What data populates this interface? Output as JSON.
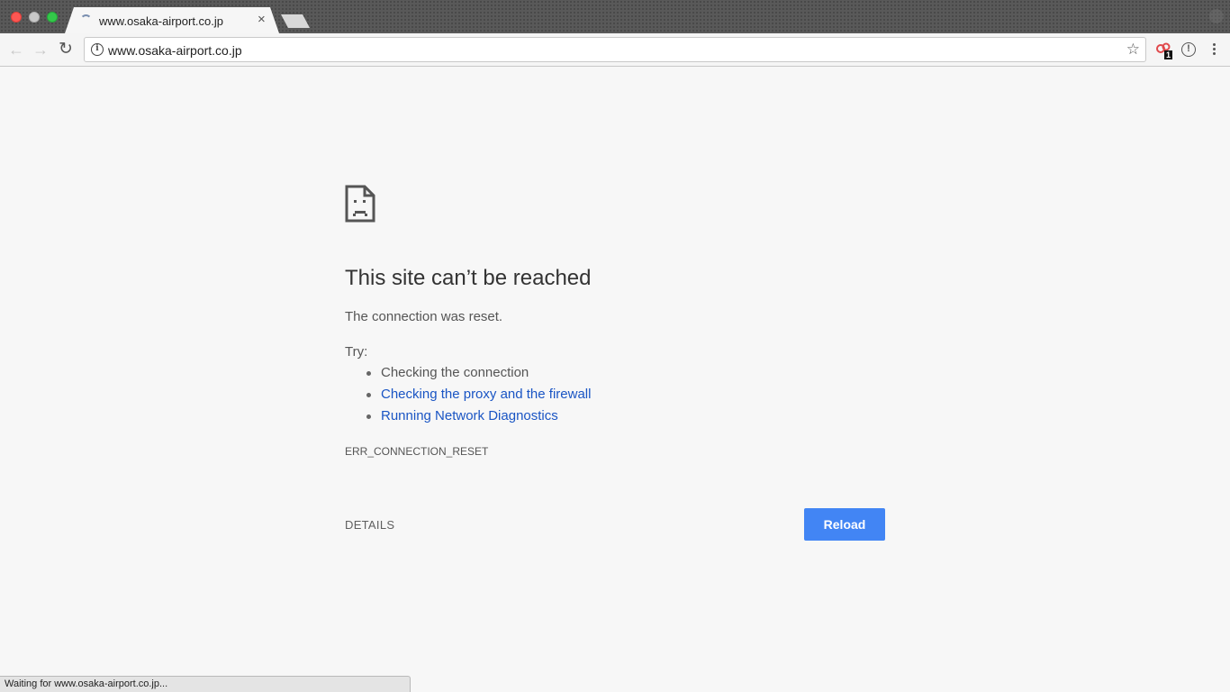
{
  "window": {
    "traffic_lights": [
      "close",
      "minimize",
      "maximize"
    ]
  },
  "tabs": [
    {
      "title": "www.osaka-airport.co.jp",
      "loading": true,
      "active": true,
      "close_label": "×"
    }
  ],
  "toolbar": {
    "back_icon": "←",
    "forward_icon": "→",
    "reload_icon": "↻",
    "url": "www.osaka-airport.co.jp",
    "info_icon": "i",
    "star_icon": "☆",
    "extension_badge": "1",
    "alert_icon": "!",
    "colors": {
      "extension_icon": "#e0484b"
    }
  },
  "error_page": {
    "heading": "This site can’t be reached",
    "description": "The connection was reset.",
    "try_label": "Try:",
    "suggestions": [
      {
        "text": "Checking the connection",
        "link": false
      },
      {
        "text": "Checking the proxy and the firewall",
        "link": true
      },
      {
        "text": "Running Network Diagnostics",
        "link": true
      }
    ],
    "error_code": "ERR_CONNECTION_RESET",
    "details_label": "DETAILS",
    "reload_label": "Reload",
    "colors": {
      "reload_button": "#4285f4",
      "link": "#1a55c4"
    }
  },
  "status_bar": {
    "text": "Waiting for www.osaka-airport.co.jp..."
  }
}
